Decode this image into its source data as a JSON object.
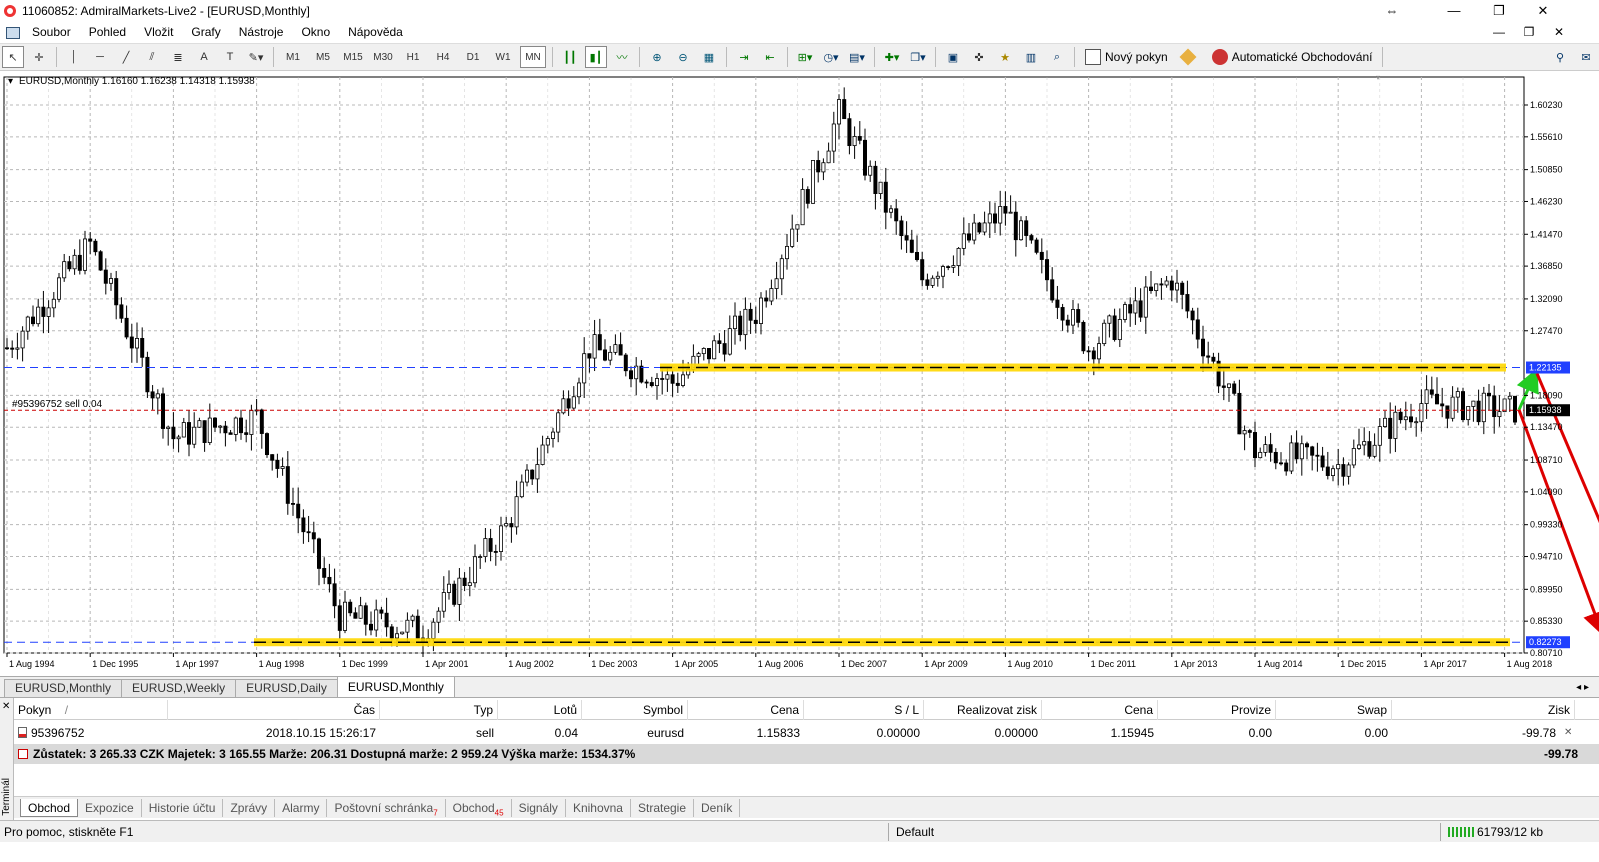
{
  "window": {
    "title": "11060852: AdmiralMarkets-Live2 - [EURUSD,Monthly]",
    "restore": "⇔",
    "minimize": "—",
    "maximize": "❐",
    "close": "✕"
  },
  "menu": {
    "items": [
      "Soubor",
      "Pohled",
      "Vložit",
      "Grafy",
      "Nástroje",
      "Okno",
      "Nápověda"
    ],
    "mdi_min": "—",
    "mdi_restore": "❐",
    "mdi_close": "✕"
  },
  "toolbar": {
    "timeframes": [
      "M1",
      "M5",
      "M15",
      "M30",
      "H1",
      "H4",
      "D1",
      "W1",
      "MN"
    ],
    "active_timeframe": "MN",
    "new_order": "Nový pokyn",
    "auto_trading": "Automatické Obchodování"
  },
  "chart": {
    "header": "EURUSD,Monthly  1.16160 1.16238 1.14318 1.15938",
    "order_label": "#95396752 sell 0.04",
    "price_tags": {
      "upper": "1.22135",
      "current": "1.15938",
      "lower": "0.82273"
    },
    "axis_text_color": "#000000",
    "grid_color": "#b8b8b8",
    "upper_level_color": "#ffd700",
    "order_line_color": "#cc0000",
    "blue_line_color": "#2040ff"
  },
  "chart_data": {
    "type": "candlestick",
    "y_ticks": [
      "1.60230",
      "1.55610",
      "1.50850",
      "1.46230",
      "1.41470",
      "1.36850",
      "1.32090",
      "1.27470",
      "1.22135",
      "1.18090",
      "1.15938",
      "1.13470",
      "1.08710",
      "1.04090",
      "0.99330",
      "0.94710",
      "0.89950",
      "0.85330",
      "0.82273",
      "0.80710"
    ],
    "x_ticks": [
      "1 Aug 1994",
      "1 Dec 1995",
      "1 Apr 1997",
      "1 Aug 1998",
      "1 Dec 1999",
      "1 Apr 2001",
      "1 Aug 2002",
      "1 Dec 2003",
      "1 Apr 2005",
      "1 Aug 2006",
      "1 Dec 2007",
      "1 Apr 2009",
      "1 Aug 2010",
      "1 Dec 2011",
      "1 Apr 2013",
      "1 Aug 2014",
      "1 Dec 2015",
      "1 Apr 2017",
      "1 Aug 2018"
    ],
    "ylim": [
      0.8071,
      1.6255
    ],
    "key_closes": [
      {
        "x": "1 Aug 1994",
        "y": 1.25
      },
      {
        "x": "1 Dec 1995",
        "y": 1.4
      },
      {
        "x": "1 Apr 1997",
        "y": 1.12
      },
      {
        "x": "1 Aug 1998",
        "y": 1.15
      },
      {
        "x": "1 Dec 1999",
        "y": 0.86
      },
      {
        "x": "1 Apr 2001",
        "y": 0.84
      },
      {
        "x": "1 Aug 2002",
        "y": 0.99
      },
      {
        "x": "1 Dec 2003",
        "y": 1.25
      },
      {
        "x": "1 Apr 2005",
        "y": 1.2
      },
      {
        "x": "1 Aug 2006",
        "y": 1.3
      },
      {
        "x": "1 Dec 2007",
        "y": 1.59
      },
      {
        "x": "1 Apr 2009",
        "y": 1.35
      },
      {
        "x": "1 Aug 2010",
        "y": 1.45
      },
      {
        "x": "1 Dec 2011",
        "y": 1.25
      },
      {
        "x": "1 Apr 2013",
        "y": 1.35
      },
      {
        "x": "1 Aug 2014",
        "y": 1.1
      },
      {
        "x": "1 Dec 2015",
        "y": 1.08
      },
      {
        "x": "1 Apr 2017",
        "y": 1.17
      },
      {
        "x": "1 Aug 2018",
        "y": 1.16
      }
    ],
    "levels": [
      1.22135,
      1.15938,
      0.82273
    ],
    "arrows": [
      {
        "from": {
          "x": "1 Aug 2018",
          "y": 1.16
        },
        "to": {
          "y": 1.22135
        },
        "color": "#22cc22"
      },
      {
        "from": {
          "x": "1 Aug 2018",
          "y": 1.16
        },
        "to": {
          "y": 0.82273
        },
        "color": "#dd0000"
      },
      {
        "from": {
          "y": 1.22135
        },
        "to": {
          "y": 0.82273
        },
        "color": "#dd0000"
      }
    ]
  },
  "chart_tabs": [
    "EURUSD,Monthly",
    "EURUSD,Weekly",
    "EURUSD,Daily",
    "EURUSD,Monthly"
  ],
  "terminal": {
    "side_label": "Terminál",
    "columns": [
      "Pokyn",
      "Čas",
      "Typ",
      "Lotů",
      "Symbol",
      "Cena",
      "S / L",
      "Realizovat zisk",
      "Cena",
      "Provize",
      "Swap",
      "Zisk"
    ],
    "sort_mark": "/",
    "order": {
      "ticket": "95396752",
      "time": "2018.10.15 15:26:17",
      "type": "sell",
      "lots": "0.04",
      "symbol": "eurusd",
      "price": "1.15833",
      "sl": "0.00000",
      "tp": "0.00000",
      "current": "1.15945",
      "commission": "0.00",
      "swap": "0.00",
      "profit": "-99.78"
    },
    "balance_line": "Zůstatek: 3 265.33 CZK  Majetek: 3 165.55  Marže: 206.31  Dostupná marže: 2 959.24  Výška marže: 1534.37%",
    "balance_profit": "-99.78",
    "tabs": [
      {
        "label": "Obchod",
        "badge": ""
      },
      {
        "label": "Expozice",
        "badge": ""
      },
      {
        "label": "Historie účtu",
        "badge": ""
      },
      {
        "label": "Zprávy",
        "badge": ""
      },
      {
        "label": "Alarmy",
        "badge": ""
      },
      {
        "label": "Poštovní schránka",
        "badge": "7"
      },
      {
        "label": "Obchod",
        "badge": "45"
      },
      {
        "label": "Signály",
        "badge": ""
      },
      {
        "label": "Knihovna",
        "badge": ""
      },
      {
        "label": "Strategie",
        "badge": ""
      },
      {
        "label": "Deník",
        "badge": ""
      }
    ]
  },
  "status": {
    "help": "Pro pomoc, stiskněte F1",
    "profile": "Default",
    "traffic": "61793/12 kb"
  }
}
